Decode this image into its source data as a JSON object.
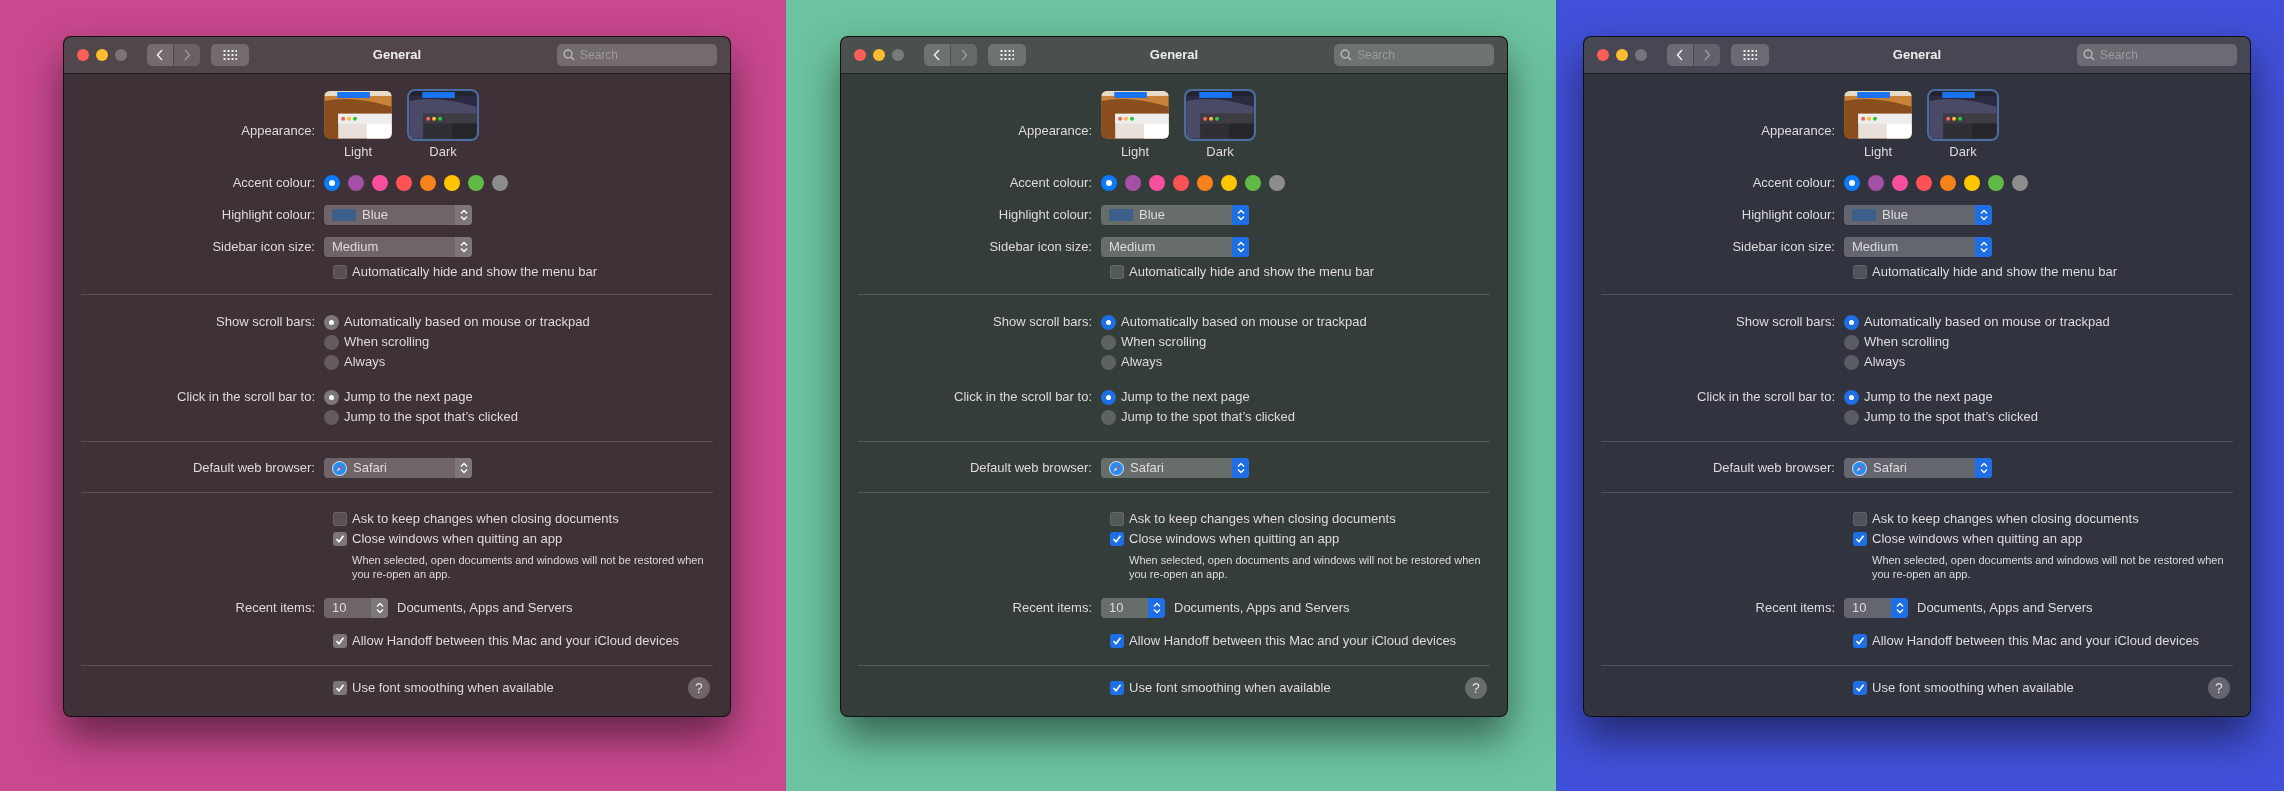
{
  "windows": [
    {
      "color": "#c9488f",
      "title": "General",
      "search": {
        "placeholder": "Search"
      },
      "help": "?",
      "sections": [
        {
          "rows": [
            {
              "kind": "appearance",
              "label": "Appearance:",
              "options": [
                {
                  "label": "Light",
                  "selected": false,
                  "kind": "light"
                },
                {
                  "label": "Dark",
                  "selected": true,
                  "kind": "dark"
                }
              ]
            },
            {
              "kind": "swatches",
              "label": "Accent colour:",
              "swatches": [
                {
                  "color": "#0a7aff",
                  "selected": true
                },
                {
                  "color": "#a550a7",
                  "selected": false
                },
                {
                  "color": "#f74f9e",
                  "selected": false
                },
                {
                  "color": "#ff5257",
                  "selected": false
                },
                {
                  "color": "#f7821b",
                  "selected": false
                },
                {
                  "color": "#ffc600",
                  "selected": false
                },
                {
                  "color": "#62ba46",
                  "selected": false
                },
                {
                  "color": "#8c8c8c",
                  "selected": false
                }
              ]
            },
            {
              "kind": "popup",
              "label": "Highlight colour:",
              "value": "Blue",
              "color": "#3d5f8c"
            },
            {
              "kind": "popup",
              "label": "Sidebar icon size:",
              "value": "Medium"
            },
            {
              "kind": "checkbox",
              "text": "Automatically hide and show the menu bar",
              "checked": false
            }
          ]
        },
        {
          "rows": [
            {
              "kind": "radios",
              "label": "Show scroll bars:",
              "options": [
                {
                  "label": "Automatically based on mouse or trackpad",
                  "selected": true
                },
                {
                  "label": "When scrolling",
                  "selected": false
                },
                {
                  "label": "Always",
                  "selected": false
                }
              ]
            },
            {
              "kind": "radios",
              "label": "Click in the scroll bar to:",
              "options": [
                {
                  "label": "Jump to the next page",
                  "selected": true
                },
                {
                  "label": "Jump to the spot that’s clicked",
                  "selected": false
                }
              ]
            }
          ]
        },
        {
          "rows": [
            {
              "kind": "app_popup",
              "label": "Default web browser:",
              "value": "Safari"
            }
          ]
        },
        {
          "rows": [
            {
              "kind": "checkbox",
              "text": "Ask to keep changes when closing documents",
              "checked": false
            },
            {
              "kind": "checkbox",
              "text": "Close windows when quitting an app",
              "checked": true,
              "note": "When selected, open documents and windows will not be restored when you re-open an app."
            },
            {
              "kind": "stepper",
              "label": "Recent items:",
              "value": "10",
              "suffix": "Documents, Apps and Servers"
            },
            {
              "kind": "checkbox",
              "text": "Allow Handoff between this Mac and your iCloud devices",
              "checked": true
            }
          ]
        },
        {
          "rows": [
            {
              "kind": "checkbox",
              "text": "Use font smoothing when available",
              "checked": true
            }
          ]
        }
      ]
    },
    {
      "color": "#6cc4a0",
      "title": "General",
      "search": {
        "placeholder": "Search"
      },
      "help": "?",
      "sections": [
        {
          "rows": [
            {
              "kind": "appearance",
              "label": "Appearance:",
              "options": [
                {
                  "label": "Light",
                  "selected": false,
                  "kind": "light"
                },
                {
                  "label": "Dark",
                  "selected": true,
                  "kind": "dark"
                }
              ]
            },
            {
              "kind": "swatches",
              "label": "Accent colour:",
              "swatches": [
                {
                  "color": "#0a7aff",
                  "selected": true
                },
                {
                  "color": "#a550a7",
                  "selected": false
                },
                {
                  "color": "#f74f9e",
                  "selected": false
                },
                {
                  "color": "#ff5257",
                  "selected": false
                },
                {
                  "color": "#f7821b",
                  "selected": false
                },
                {
                  "color": "#ffc600",
                  "selected": false
                },
                {
                  "color": "#62ba46",
                  "selected": false
                },
                {
                  "color": "#8c8c8c",
                  "selected": false
                }
              ]
            },
            {
              "kind": "popup",
              "label": "Highlight colour:",
              "value": "Blue",
              "color": "#3d5f8c"
            },
            {
              "kind": "popup",
              "label": "Sidebar icon size:",
              "value": "Medium"
            },
            {
              "kind": "checkbox",
              "text": "Automatically hide and show the menu bar",
              "checked": false
            }
          ]
        },
        {
          "rows": [
            {
              "kind": "radios",
              "label": "Show scroll bars:",
              "options": [
                {
                  "label": "Automatically based on mouse or trackpad",
                  "selected": true
                },
                {
                  "label": "When scrolling",
                  "selected": false
                },
                {
                  "label": "Always",
                  "selected": false
                }
              ]
            },
            {
              "kind": "radios",
              "label": "Click in the scroll bar to:",
              "options": [
                {
                  "label": "Jump to the next page",
                  "selected": true
                },
                {
                  "label": "Jump to the spot that’s clicked",
                  "selected": false
                }
              ]
            }
          ]
        },
        {
          "rows": [
            {
              "kind": "app_popup",
              "label": "Default web browser:",
              "value": "Safari"
            }
          ]
        },
        {
          "rows": [
            {
              "kind": "checkbox",
              "text": "Ask to keep changes when closing documents",
              "checked": false
            },
            {
              "kind": "checkbox",
              "text": "Close windows when quitting an app",
              "checked": true,
              "note": "When selected, open documents and windows will not be restored when you re-open an app."
            },
            {
              "kind": "stepper",
              "label": "Recent items:",
              "value": "10",
              "suffix": "Documents, Apps and Servers"
            },
            {
              "kind": "checkbox",
              "text": "Allow Handoff between this Mac and your iCloud devices",
              "checked": true
            }
          ]
        },
        {
          "rows": [
            {
              "kind": "checkbox",
              "text": "Use font smoothing when available",
              "checked": true
            }
          ]
        }
      ]
    },
    {
      "color": "#4150d8",
      "title": "General",
      "search": {
        "placeholder": "Search"
      },
      "help": "?",
      "sections": [
        {
          "rows": [
            {
              "kind": "appearance",
              "label": "Appearance:",
              "options": [
                {
                  "label": "Light",
                  "selected": false,
                  "kind": "light"
                },
                {
                  "label": "Dark",
                  "selected": true,
                  "kind": "dark"
                }
              ]
            },
            {
              "kind": "swatches",
              "label": "Accent colour:",
              "swatches": [
                {
                  "color": "#0a7aff",
                  "selected": true
                },
                {
                  "color": "#a550a7",
                  "selected": false
                },
                {
                  "color": "#f74f9e",
                  "selected": false
                },
                {
                  "color": "#ff5257",
                  "selected": false
                },
                {
                  "color": "#f7821b",
                  "selected": false
                },
                {
                  "color": "#ffc600",
                  "selected": false
                },
                {
                  "color": "#62ba46",
                  "selected": false
                },
                {
                  "color": "#8c8c8c",
                  "selected": false
                }
              ]
            },
            {
              "kind": "popup",
              "label": "Highlight colour:",
              "value": "Blue",
              "color": "#3d5f8c"
            },
            {
              "kind": "popup",
              "label": "Sidebar icon size:",
              "value": "Medium"
            },
            {
              "kind": "checkbox",
              "text": "Automatically hide and show the menu bar",
              "checked": false
            }
          ]
        },
        {
          "rows": [
            {
              "kind": "radios",
              "label": "Show scroll bars:",
              "options": [
                {
                  "label": "Automatically based on mouse or trackpad",
                  "selected": true
                },
                {
                  "label": "When scrolling",
                  "selected": false
                },
                {
                  "label": "Always",
                  "selected": false
                }
              ]
            },
            {
              "kind": "radios",
              "label": "Click in the scroll bar to:",
              "options": [
                {
                  "label": "Jump to the next page",
                  "selected": true
                },
                {
                  "label": "Jump to the spot that’s clicked",
                  "selected": false
                }
              ]
            }
          ]
        },
        {
          "rows": [
            {
              "kind": "app_popup",
              "label": "Default web browser:",
              "value": "Safari"
            }
          ]
        },
        {
          "rows": [
            {
              "kind": "checkbox",
              "text": "Ask to keep changes when closing documents",
              "checked": false
            },
            {
              "kind": "checkbox",
              "text": "Close windows when quitting an app",
              "checked": true,
              "note": "When selected, open documents and windows will not be restored when you re-open an app."
            },
            {
              "kind": "stepper",
              "label": "Recent items:",
              "value": "10",
              "suffix": "Documents, Apps and Servers"
            },
            {
              "kind": "checkbox",
              "text": "Allow Handoff between this Mac and your iCloud devices",
              "checked": true
            }
          ]
        },
        {
          "rows": [
            {
              "kind": "checkbox",
              "text": "Use font smoothing when available",
              "checked": true
            }
          ]
        }
      ]
    }
  ]
}
